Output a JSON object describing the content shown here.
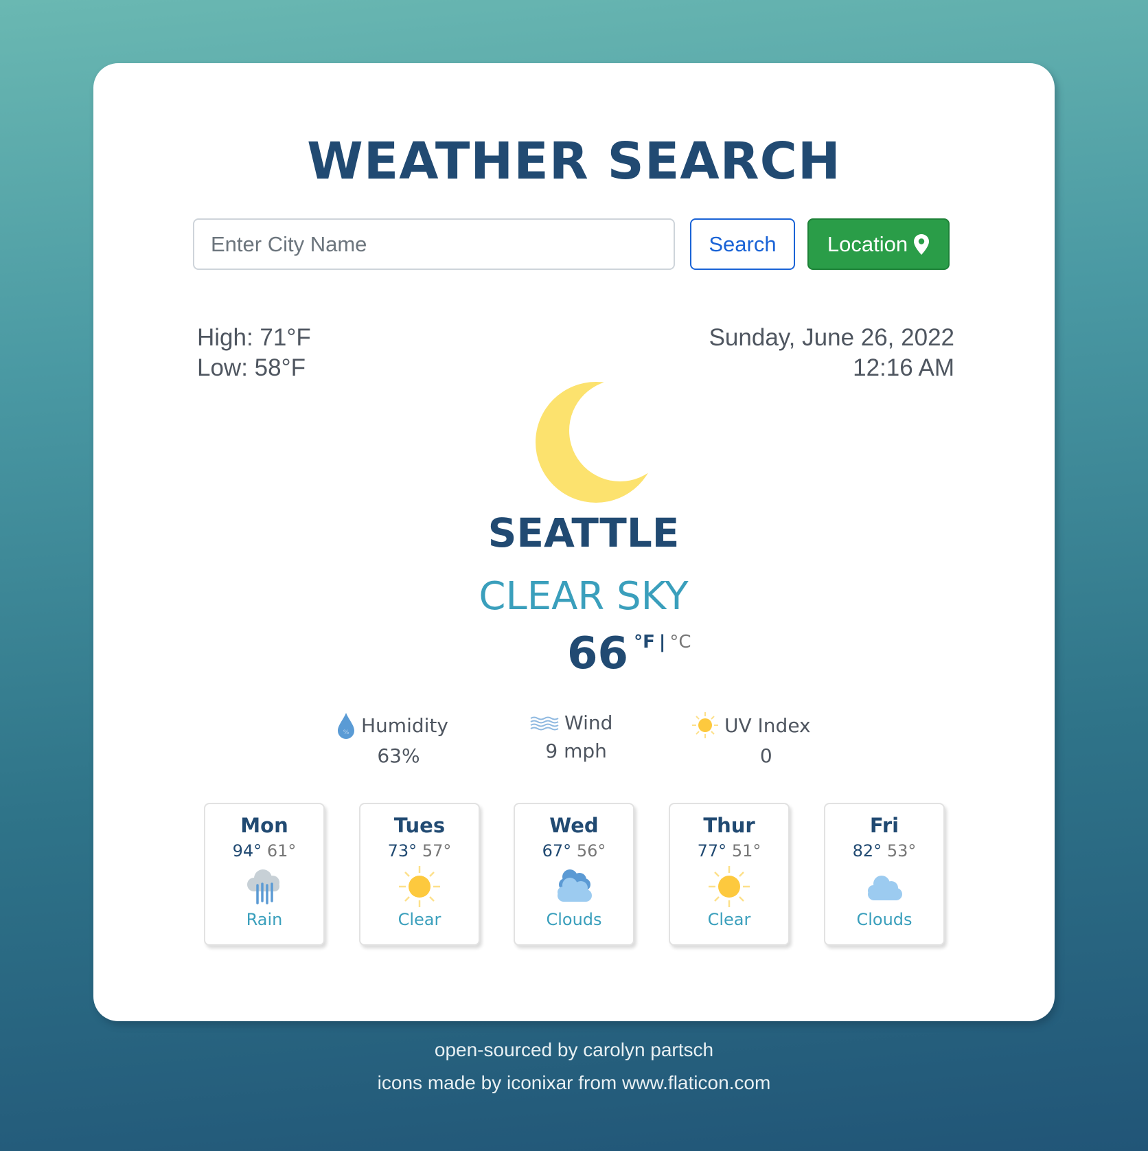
{
  "app": {
    "title": "WEATHER SEARCH"
  },
  "search": {
    "placeholder": "Enter City Name",
    "value": "",
    "search_label": "Search",
    "location_label": "Location",
    "location_icon": "map-pin-icon"
  },
  "current": {
    "high": "High: 71°F",
    "low": "Low: 58°F",
    "date": "Sunday, June 26, 2022",
    "time": "12:16 AM",
    "icon": "moon-icon",
    "city": "SEATTLE",
    "condition": "CLEAR SKY",
    "temperature": "66",
    "unit_f": "°F",
    "unit_separator": "|",
    "unit_c": "°C",
    "active_unit": "F"
  },
  "stats": {
    "humidity": {
      "label": "Humidity",
      "value": "63%",
      "icon": "humidity-drop-icon"
    },
    "wind": {
      "label": "Wind",
      "value": "9 mph",
      "icon": "wind-icon"
    },
    "uv": {
      "label": "UV Index",
      "value": "0",
      "icon": "sun-icon"
    }
  },
  "forecast": [
    {
      "day": "Mon",
      "high": "94°",
      "low": "61°",
      "icon": "rain-icon",
      "description": "Rain"
    },
    {
      "day": "Tues",
      "high": "73°",
      "low": "57°",
      "icon": "sun-icon",
      "description": "Clear"
    },
    {
      "day": "Wed",
      "high": "67°",
      "low": "56°",
      "icon": "clouds-icon",
      "description": "Clouds"
    },
    {
      "day": "Thur",
      "high": "77°",
      "low": "51°",
      "icon": "sun-icon",
      "description": "Clear"
    },
    {
      "day": "Fri",
      "high": "82°",
      "low": "53°",
      "icon": "cloud-icon",
      "description": "Clouds"
    }
  ],
  "footer": {
    "line1": "open-sourced by carolyn partsch",
    "line2": "icons made by iconixar from www.flaticon.com"
  },
  "colors": {
    "primary": "#214a72",
    "accent": "#3a9fbc",
    "search_button": "#1a63d6",
    "location_button": "#2a9d48",
    "moon": "#fce26e",
    "sun": "#fdc93e"
  }
}
